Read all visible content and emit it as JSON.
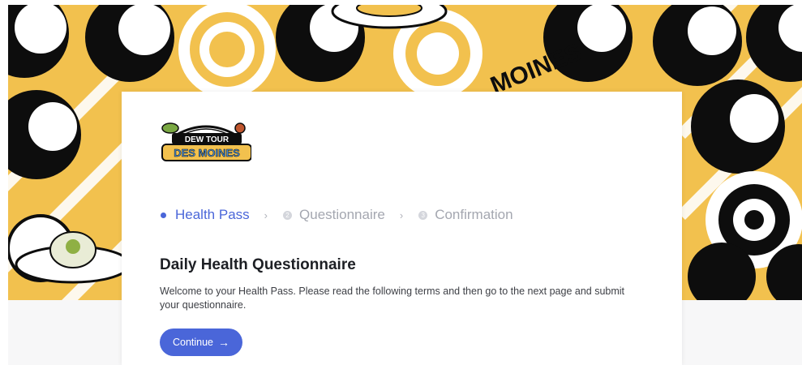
{
  "hero": {
    "banner_word": "MOINES",
    "colors": {
      "yellow": "#f2c14e",
      "black": "#0d0d0d",
      "white": "#ffffff"
    }
  },
  "logo": {
    "line1": "DEW TOUR",
    "line2": "DES MOINES"
  },
  "steps": [
    {
      "label": "Health Pass",
      "number": "1",
      "state": "active"
    },
    {
      "label": "Questionnaire",
      "number": "2",
      "state": "inactive"
    },
    {
      "label": "Confirmation",
      "number": "3",
      "state": "inactive"
    }
  ],
  "main": {
    "title": "Daily Health Questionnaire",
    "description": "Welcome to your Health Pass. Please read the following terms and then go to the next page and submit your questionnaire.",
    "continue_label": "Continue",
    "continue_icon": "arrow-right-icon",
    "accent": "#4a66d9"
  }
}
